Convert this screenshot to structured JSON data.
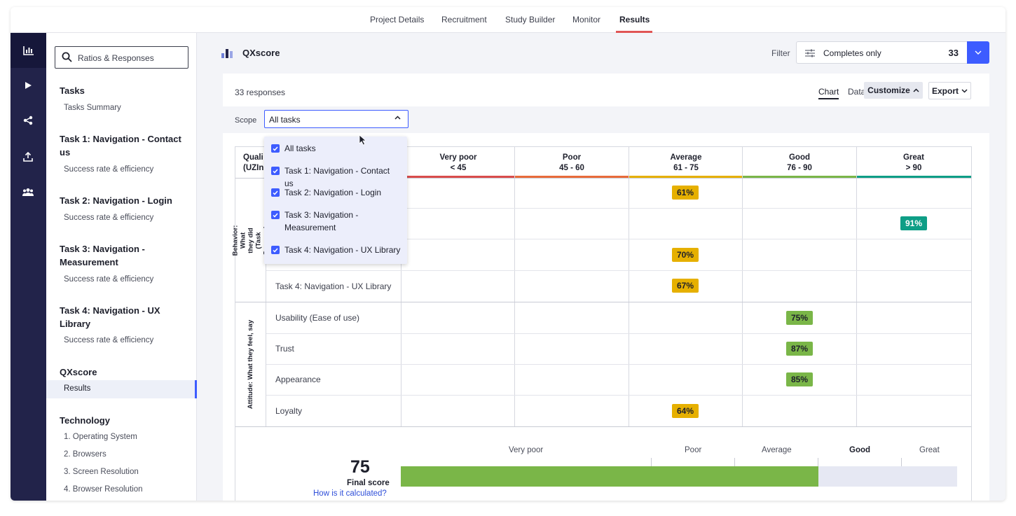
{
  "nav": {
    "tabs": [
      {
        "label": "Project Details",
        "active": false
      },
      {
        "label": "Recruitment",
        "active": false
      },
      {
        "label": "Study Builder",
        "active": false
      },
      {
        "label": "Monitor",
        "active": false
      },
      {
        "label": "Results",
        "active": true
      }
    ],
    "accent_color": "#e05555"
  },
  "rail": {
    "icons": [
      "bar-chart-icon",
      "play-icon",
      "share-icon",
      "upload-icon",
      "users-icon"
    ]
  },
  "sidebar": {
    "search_placeholder": "Ratios & Responses",
    "sections": [
      {
        "title": "Tasks",
        "items": [
          "Tasks Summary"
        ]
      },
      {
        "title": "Task 1: Navigation - Contact us",
        "items": [
          "Success rate & efficiency"
        ]
      },
      {
        "title": "Task 2: Navigation - Login",
        "items": [
          "Success rate & efficiency"
        ]
      },
      {
        "title": "Task 3: Navigation - Measurement",
        "items": [
          "Success rate & efficiency"
        ]
      },
      {
        "title": "Task 4: Navigation - UX Library",
        "items": [
          "Success rate & efficiency"
        ]
      },
      {
        "title": "QXscore",
        "items": [
          "Results"
        ]
      },
      {
        "title": "Technology",
        "items": [
          "1. Operating System",
          "2. Browsers",
          "3. Screen Resolution",
          "4. Browser Resolution"
        ]
      }
    ],
    "selected": "Results"
  },
  "header": {
    "title": "QXscore",
    "filter_label": "Filter",
    "filter_value": "Completes only",
    "filter_count": "33"
  },
  "card": {
    "responses": "33 responses",
    "view_tabs": [
      {
        "label": "Chart",
        "active": true
      },
      {
        "label": "Data",
        "active": false
      }
    ],
    "customize_label": "Customize",
    "export_label": "Export",
    "scope_label": "Scope",
    "scope_value": "All tasks"
  },
  "dropdown": {
    "options": [
      {
        "label": "All tasks",
        "checked": true
      },
      {
        "label": "Task 1: Navigation - Contact us",
        "checked": true
      },
      {
        "label": "Task 2: Navigation - Login",
        "checked": true
      },
      {
        "label": "Task 3: Navigation - Measurement",
        "checked": true
      },
      {
        "label": "Task 4: Navigation - UX Library",
        "checked": true
      }
    ]
  },
  "table": {
    "quality_header_fragment": [
      "Quali",
      "(UZIn"
    ],
    "columns": [
      {
        "label": "Very poor",
        "range": "< 45",
        "color": "#d94c4c"
      },
      {
        "label": "Poor",
        "range": "45 - 60",
        "color": "#e86b3a"
      },
      {
        "label": "Average",
        "range": "61 - 75",
        "color": "#e6b000"
      },
      {
        "label": "Good",
        "range": "76 - 90",
        "color": "#7ab648"
      },
      {
        "label": "Great",
        "range": "> 90",
        "color": "#0e9e86"
      }
    ],
    "groups": [
      {
        "label": "Behavior: What they did (Task Success)"
      },
      {
        "label": "Attitude: What they feel, say"
      }
    ],
    "rows": [
      {
        "label": "",
        "value": "61%",
        "column": 2
      },
      {
        "label": "",
        "value": "91%",
        "column": 4
      },
      {
        "label": "",
        "value": "70%",
        "column": 2
      },
      {
        "label": "Task 4: Navigation - UX Library",
        "value": "67%",
        "column": 2
      },
      {
        "label": "Usability (Ease of use)",
        "value": "75%",
        "column": 3
      },
      {
        "label": "Trust",
        "value": "87%",
        "column": 3
      },
      {
        "label": "Appearance",
        "value": "85%",
        "column": 3
      },
      {
        "label": "Loyalty",
        "value": "64%",
        "column": 2
      }
    ]
  },
  "score": {
    "value": "75",
    "label": "Final score",
    "link": "How is it calculated?",
    "scale": [
      "Very poor",
      "Poor",
      "Average",
      "Good",
      "Great"
    ],
    "highlight": "Good",
    "bar_value": 75,
    "bar_max": 100
  }
}
